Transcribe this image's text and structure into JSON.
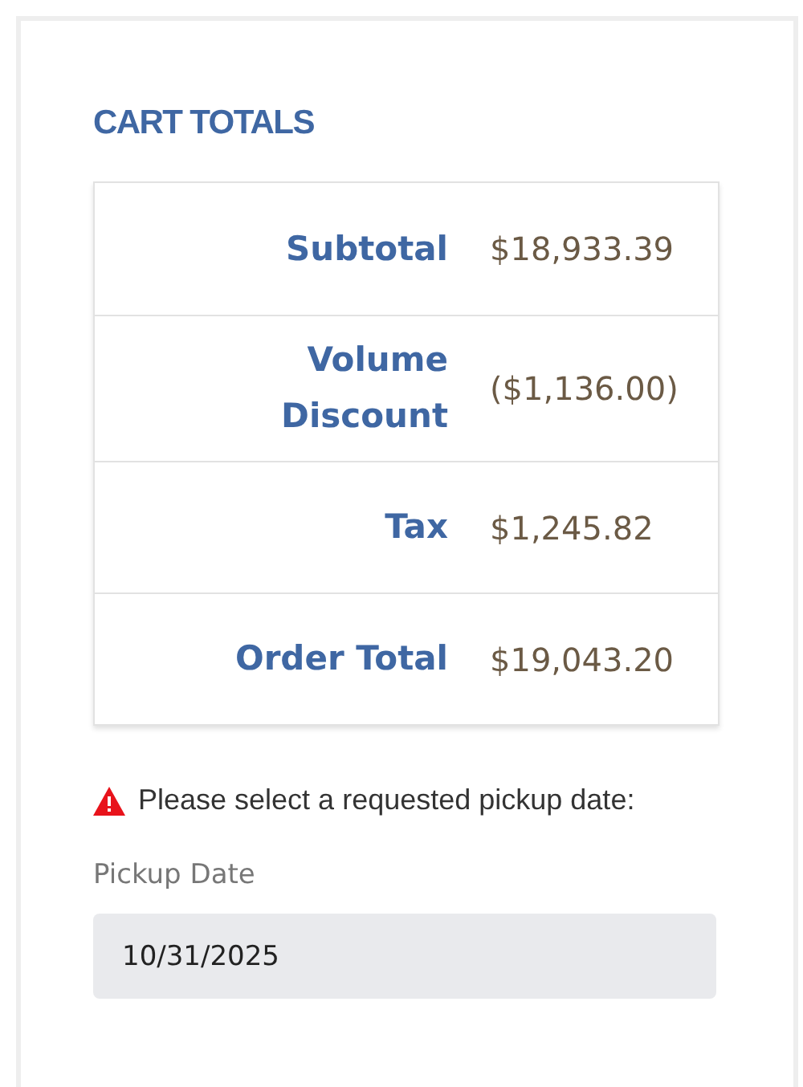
{
  "title": "CART TOTALS",
  "totals": [
    {
      "label": "Subtotal",
      "value": "$18,933.39"
    },
    {
      "label": "Volume Discount",
      "value": "($1,136.00)"
    },
    {
      "label": "Tax",
      "value": "$1,245.82"
    },
    {
      "label": "Order Total",
      "value": "$19,043.20"
    }
  ],
  "warning": "Please select a requested pickup date:",
  "pickup": {
    "label": "Pickup Date",
    "value": "10/31/2025"
  }
}
